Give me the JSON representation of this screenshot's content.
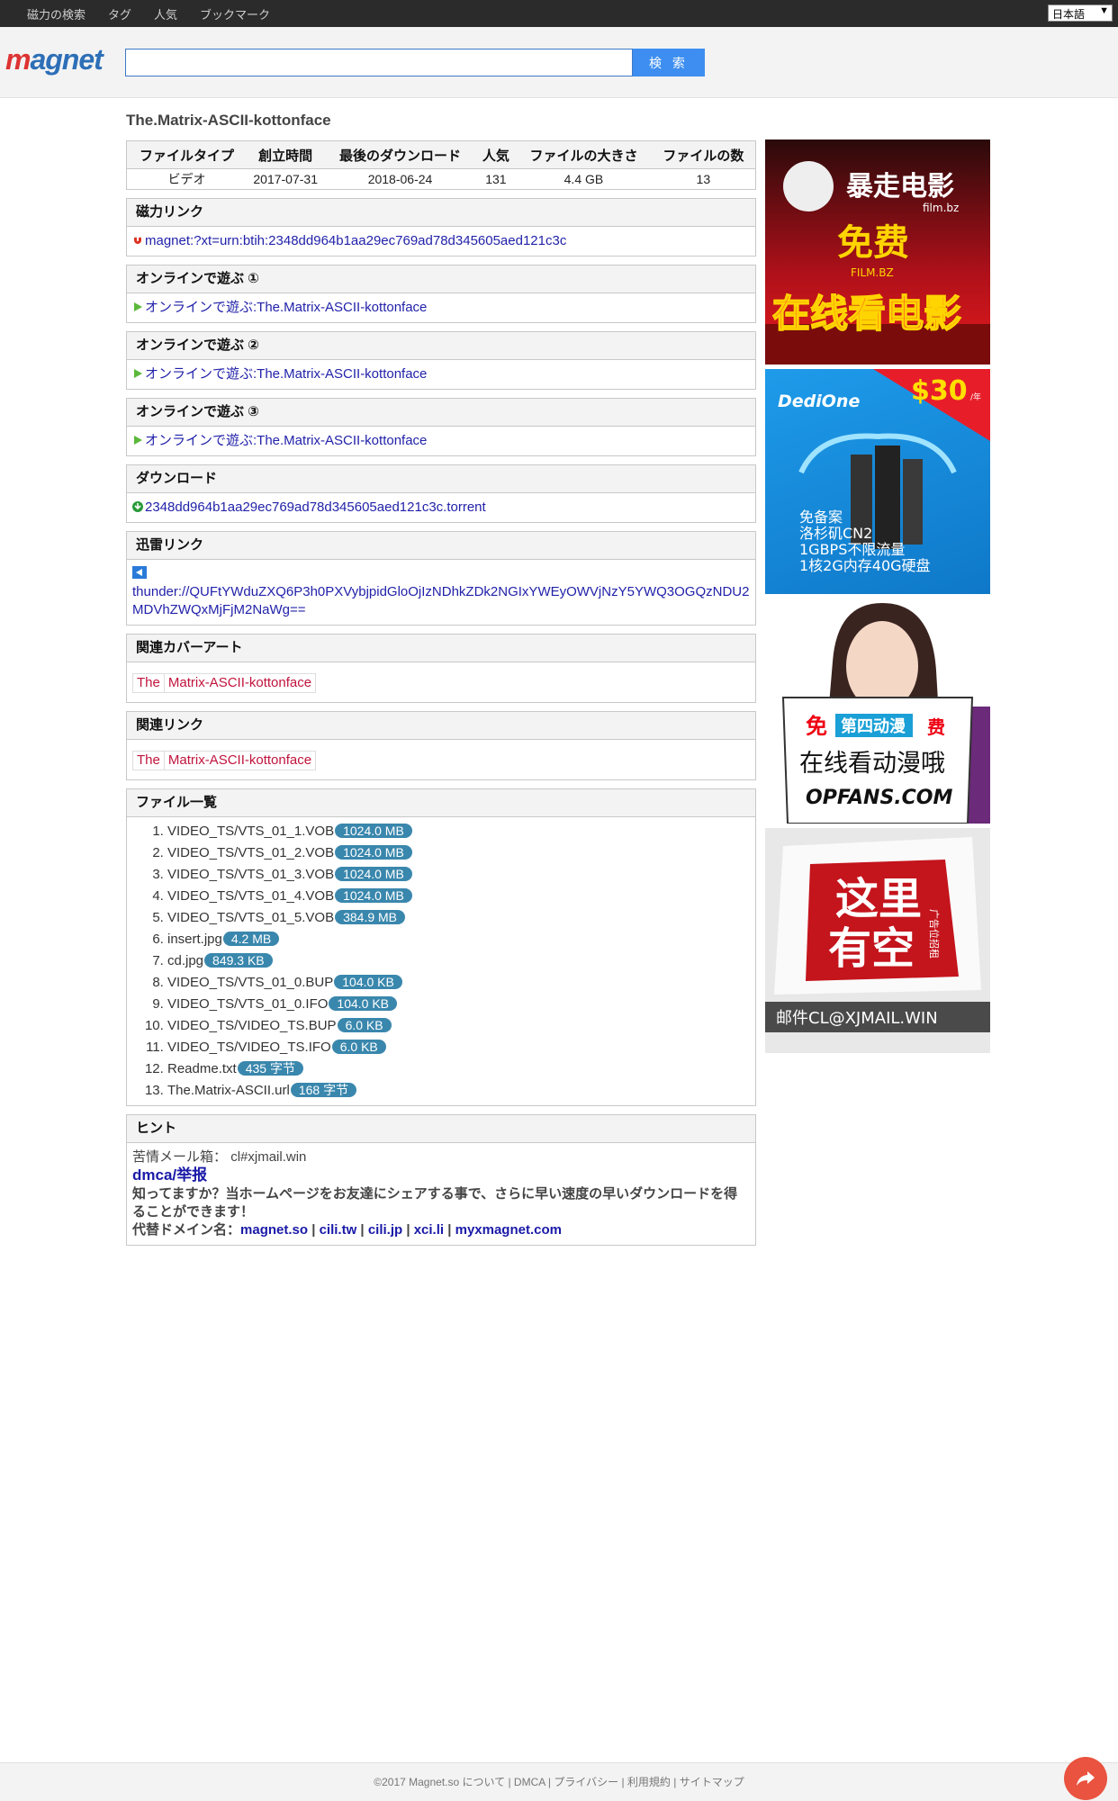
{
  "topnav": {
    "items": [
      "磁力の検索",
      "タグ",
      "人気",
      "ブックマーク"
    ],
    "language": "日本語"
  },
  "header": {
    "logo": "magnet",
    "search_value": "",
    "search_button": "検 索"
  },
  "page": {
    "title": "The.Matrix-ASCII-kottonface"
  },
  "info_table": {
    "headers": [
      "ファイルタイプ",
      "創立時間",
      "最後のダウンロード",
      "人気",
      "ファイルの大きさ",
      "ファイルの数"
    ],
    "values": [
      "ビデオ",
      "2017-07-31",
      "2018-06-24",
      "131",
      "4.4 GB",
      "13"
    ]
  },
  "magnet": {
    "heading": "磁力リンク",
    "link": "magnet:?xt=urn:btih:2348dd964b1aa29ec769ad78d345605aed121c3c"
  },
  "online": [
    {
      "heading": "オンラインで遊ぶ ①",
      "link": "オンラインで遊ぶ:The.Matrix-ASCII-kottonface"
    },
    {
      "heading": "オンラインで遊ぶ ②",
      "link": "オンラインで遊ぶ:The.Matrix-ASCII-kottonface"
    },
    {
      "heading": "オンラインで遊ぶ ③",
      "link": "オンラインで遊ぶ:The.Matrix-ASCII-kottonface"
    }
  ],
  "download": {
    "heading": "ダウンロード",
    "link": "2348dd964b1aa29ec769ad78d345605aed121c3c.torrent"
  },
  "thunder": {
    "heading": "迅雷リンク",
    "link": "thunder://QUFtYWduZXQ6P3h0PXVybjpidGloOjIzNDhkZDk2NGIxYWEyOWVjNzY5YWQ3OGQzNDU2MDVhZWQxMjFjM2NaWg=="
  },
  "cover": {
    "heading": "関連カバーアート",
    "tags": [
      "The",
      "Matrix-ASCII-kottonface"
    ]
  },
  "related": {
    "heading": "関連リンク",
    "tags": [
      "The",
      "Matrix-ASCII-kottonface"
    ]
  },
  "files": {
    "heading": "ファイル一覧",
    "items": [
      {
        "name": "VIDEO_TS/VTS_01_1.VOB",
        "size": "1024.0 MB"
      },
      {
        "name": "VIDEO_TS/VTS_01_2.VOB",
        "size": "1024.0 MB"
      },
      {
        "name": "VIDEO_TS/VTS_01_3.VOB",
        "size": "1024.0 MB"
      },
      {
        "name": "VIDEO_TS/VTS_01_4.VOB",
        "size": "1024.0 MB"
      },
      {
        "name": "VIDEO_TS/VTS_01_5.VOB",
        "size": "384.9 MB"
      },
      {
        "name": "insert.jpg",
        "size": "4.2 MB"
      },
      {
        "name": "cd.jpg",
        "size": "849.3 KB"
      },
      {
        "name": "VIDEO_TS/VTS_01_0.BUP",
        "size": "104.0 KB"
      },
      {
        "name": "VIDEO_TS/VTS_01_0.IFO",
        "size": "104.0 KB"
      },
      {
        "name": "VIDEO_TS/VIDEO_TS.BUP",
        "size": "6.0 KB"
      },
      {
        "name": "VIDEO_TS/VIDEO_TS.IFO",
        "size": "6.0 KB"
      },
      {
        "name": "Readme.txt",
        "size": "435 字节"
      },
      {
        "name": "The.Matrix-ASCII.url",
        "size": "168 字节"
      }
    ]
  },
  "hint": {
    "heading": "ヒント",
    "complaint_label": "苦情メール箱：",
    "complaint_email": "cl#xjmail.win",
    "dmca": "dmca/举报",
    "share_text": "知ってますか？当ホームページをお友達にシェアする事で、さらに早い速度の早いダウンロードを得ることができます！",
    "domains_label": "代替ドメイン名：",
    "domains": [
      "magnet.so",
      "cili.tw",
      "cili.jp",
      "xci.li",
      "myxmagnet.com"
    ]
  },
  "ads": {
    "ad1": {
      "title": "暴走电影",
      "sub": "film.bz",
      "free": "免费",
      "brand": "FILM.BZ",
      "slogan": "在线看电影"
    },
    "ad2": {
      "brand": "DediOne",
      "price": "$30",
      "per": "/年",
      "lines": [
        "免备案",
        "洛杉矶CN2",
        "1GBPS不限流量",
        "1核2G内存40G硬盘"
      ]
    },
    "ad3": {
      "free_left": "免",
      "sign": "第四动漫",
      "free_right": "费",
      "slogan": "在线看动漫哦",
      "site": "OPFANS.COM"
    },
    "ad4": {
      "text1": "这里",
      "text2": "有空",
      "side": "广告位招租",
      "email": "邮件CL@XJMAIL.WIN"
    }
  },
  "footer": {
    "text": "©2017 Magnet.so について | DMCA | プライバシー | 利用規約 | サイトマップ"
  },
  "colors": {
    "topbar": "#2b2b2b",
    "search_button": "#3d8ef0",
    "badge": "#3a87ad",
    "tag": "#c0143c",
    "link": "#2222aa",
    "share_button": "#e9533f"
  }
}
